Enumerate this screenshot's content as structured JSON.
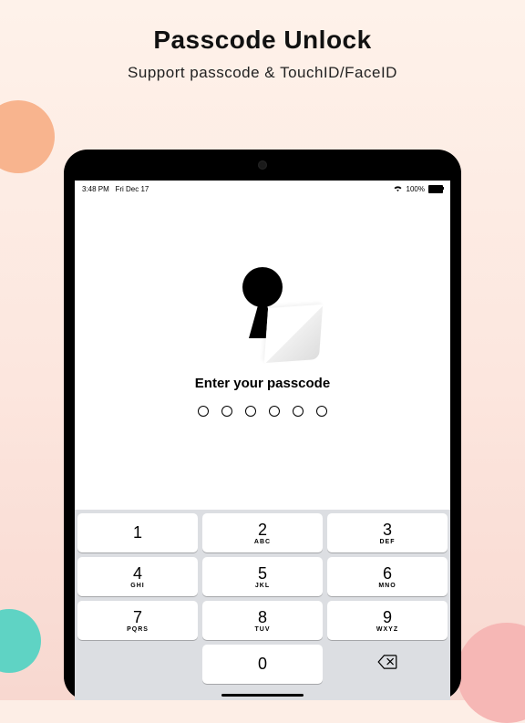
{
  "marketing": {
    "headline": "Passcode Unlock",
    "subhead": "Support  passcode & TouchID/FaceID"
  },
  "status": {
    "time": "3:48 PM",
    "date": "Fri Dec 17",
    "battery": "100%"
  },
  "lock": {
    "prompt": "Enter your passcode",
    "length": 6,
    "entered": 0
  },
  "keypad": {
    "keys": [
      {
        "num": "1",
        "let": ""
      },
      {
        "num": "2",
        "let": "ABC"
      },
      {
        "num": "3",
        "let": "DEF"
      },
      {
        "num": "4",
        "let": "GHI"
      },
      {
        "num": "5",
        "let": "JKL"
      },
      {
        "num": "6",
        "let": "MNO"
      },
      {
        "num": "7",
        "let": "PQRS"
      },
      {
        "num": "8",
        "let": "TUV"
      },
      {
        "num": "9",
        "let": "WXYZ"
      },
      {
        "num": "0",
        "let": ""
      }
    ]
  }
}
